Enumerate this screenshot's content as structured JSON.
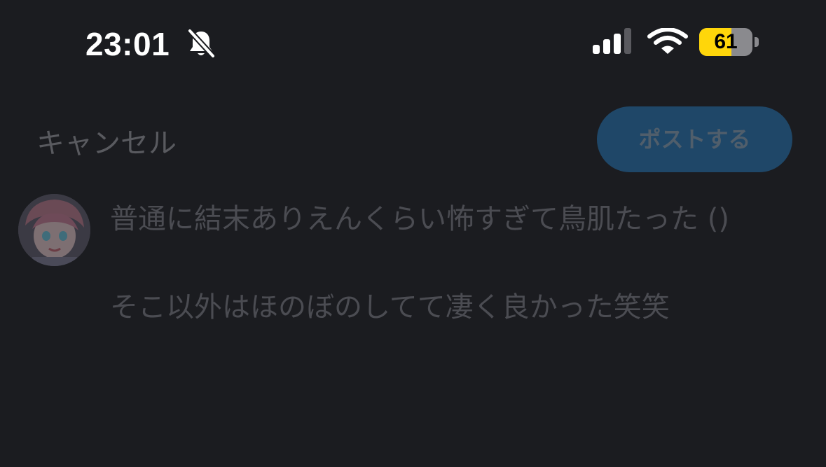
{
  "status_bar": {
    "time": "23:01",
    "silent_icon": "bell-slash-icon",
    "signal_icon": "cellular-signal-icon",
    "wifi_icon": "wifi-icon",
    "battery_level": "61",
    "battery_fraction": 0.61
  },
  "compose": {
    "cancel_label": "キャンセル",
    "post_label": "ポストする",
    "text": "普通に結末ありえんくらい怖すぎて鳥肌たった ()\n\nそこ以外はほのぼのしてて凄く良かった笑笑"
  },
  "colors": {
    "background": "#1b1c20",
    "post_button": "#1f4768",
    "battery_fill": "#ffd60a"
  }
}
